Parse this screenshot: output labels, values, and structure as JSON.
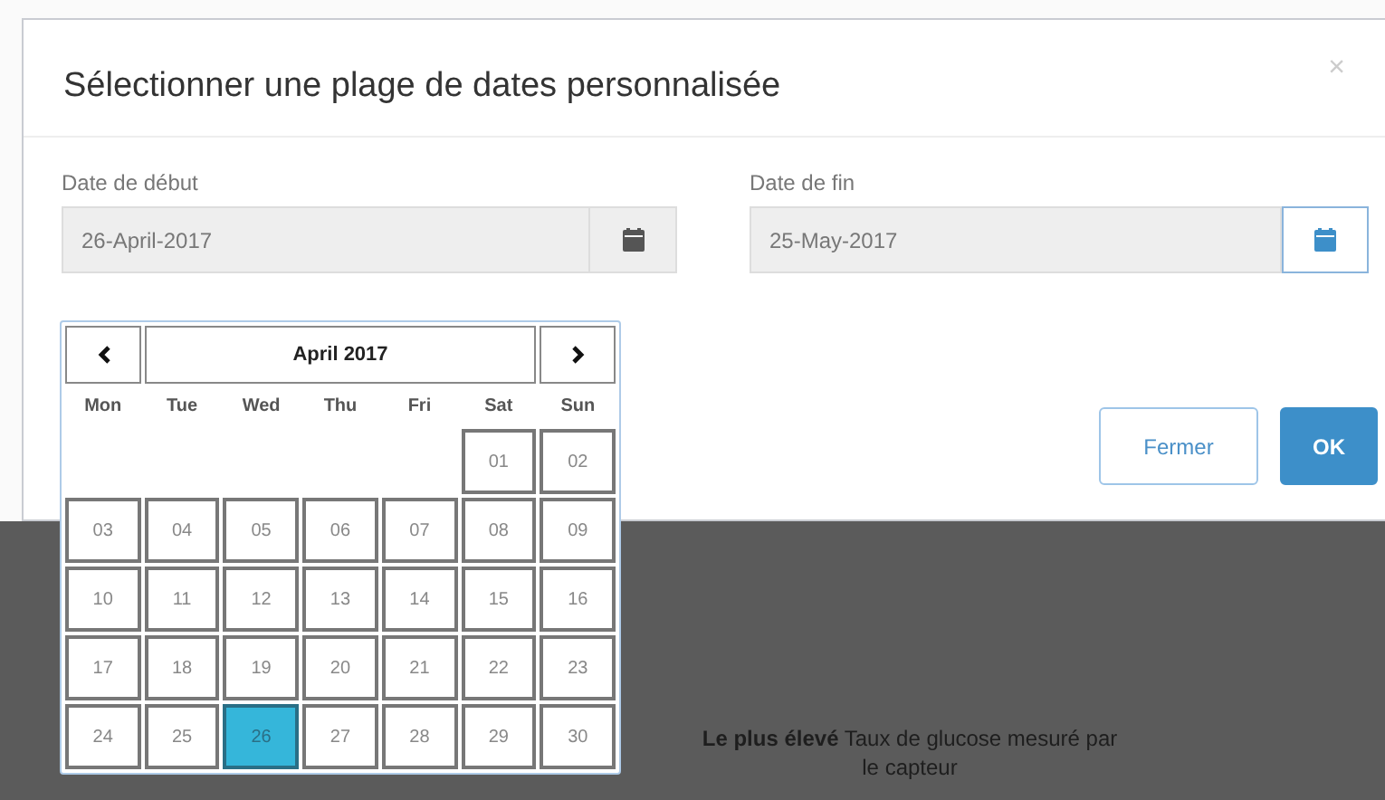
{
  "dialog": {
    "title": "Sélectionner une plage de dates personnalisée",
    "close": "×",
    "start": {
      "label": "Date de début",
      "value": "26-April-2017"
    },
    "end": {
      "label": "Date de fin",
      "value": "25-May-2017"
    },
    "buttons": [
      {
        "label": "Fermer",
        "kind": "secondary"
      },
      {
        "label": "OK",
        "kind": "primary"
      }
    ]
  },
  "calendar": {
    "month": "April 2017",
    "weekdays": [
      "Mon",
      "Tue",
      "Wed",
      "Thu",
      "Fri",
      "Sat",
      "Sun"
    ],
    "weeks": [
      [
        {
          "label": "01",
          "selected": false
        },
        {
          "label": "02",
          "selected": false
        }
      ],
      [
        {
          "label": "03",
          "selected": false
        },
        {
          "label": "04",
          "selected": false
        },
        {
          "label": "05",
          "selected": false
        },
        {
          "label": "06",
          "selected": false
        },
        {
          "label": "07",
          "selected": false
        },
        {
          "label": "08",
          "selected": false
        },
        {
          "label": "09",
          "selected": false
        }
      ],
      [
        {
          "label": "10",
          "selected": false
        },
        {
          "label": "11",
          "selected": false
        },
        {
          "label": "12",
          "selected": false
        },
        {
          "label": "13",
          "selected": false
        },
        {
          "label": "14",
          "selected": false
        },
        {
          "label": "15",
          "selected": false
        },
        {
          "label": "16",
          "selected": false
        }
      ],
      [
        {
          "label": "17",
          "selected": false
        },
        {
          "label": "18",
          "selected": false
        },
        {
          "label": "19",
          "selected": false
        },
        {
          "label": "20",
          "selected": false
        },
        {
          "label": "21",
          "selected": false
        },
        {
          "label": "22",
          "selected": false
        },
        {
          "label": "23",
          "selected": false
        }
      ],
      [
        {
          "label": "24",
          "selected": false
        },
        {
          "label": "25",
          "selected": false
        },
        {
          "label": "26",
          "selected": true
        },
        {
          "label": "27",
          "selected": false
        },
        {
          "label": "28",
          "selected": false
        },
        {
          "label": "29",
          "selected": false
        },
        {
          "label": "30",
          "selected": false
        }
      ]
    ]
  },
  "background": {
    "caption": "**Le plus élevé** Taux de glucose mesuré par le capteur"
  }
}
